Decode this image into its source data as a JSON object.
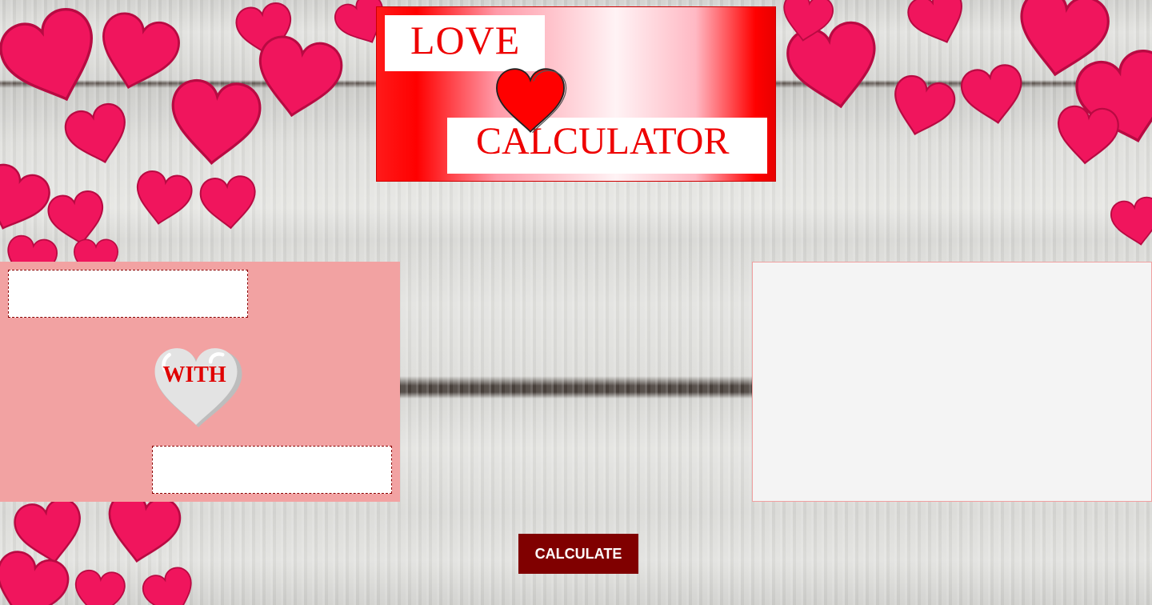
{
  "header": {
    "title_top": "LOVE",
    "title_bottom": "CALCULATOR"
  },
  "form": {
    "first_name": {
      "value": "",
      "placeholder": ""
    },
    "connector": "WITH",
    "second_name": {
      "value": "",
      "placeholder": ""
    }
  },
  "result": {
    "text": ""
  },
  "actions": {
    "calculate_label": "CALCULATE"
  },
  "colors": {
    "accent": "#ee0000",
    "button": "#800000",
    "panel_left": "#f2a2a2",
    "panel_right": "#f4f4f4",
    "heart_decor": "#f0155d"
  }
}
